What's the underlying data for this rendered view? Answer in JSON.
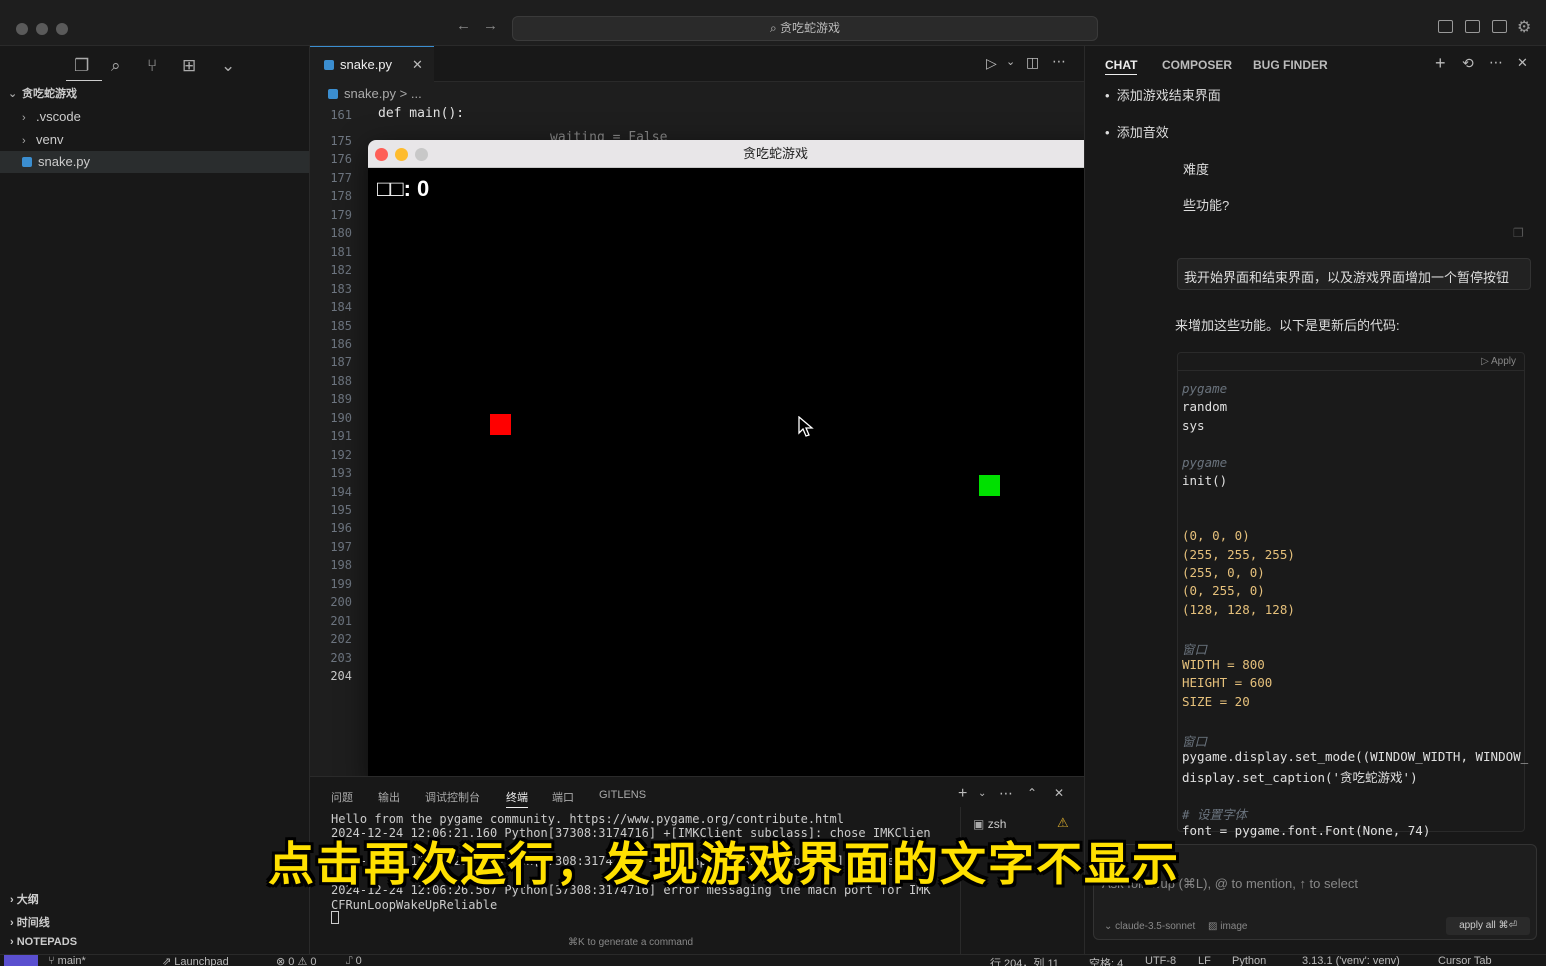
{
  "titlebar": {
    "search_label": "⌕ 贪吃蛇游戏"
  },
  "sidebar": {
    "root_folder": "贪吃蛇游戏",
    "items": [
      {
        "label": ".vscode",
        "type": "folder"
      },
      {
        "label": "venv",
        "type": "folder"
      },
      {
        "label": "snake.py",
        "type": "file",
        "selected": true
      }
    ],
    "sections": [
      "大纲",
      "时间线",
      "NOTEPADS"
    ]
  },
  "editor": {
    "tab_label": "snake.py",
    "breadcrumb": "snake.py > ...",
    "first_line_number": "161",
    "first_line_code": "def main():",
    "peek_line": "waiting = False",
    "line_numbers": [
      "175",
      "176",
      "177",
      "178",
      "179",
      "180",
      "181",
      "182",
      "183",
      "184",
      "185",
      "186",
      "187",
      "188",
      "189",
      "190",
      "191",
      "192",
      "193",
      "194",
      "195",
      "196",
      "197",
      "198",
      "199",
      "200",
      "201",
      "202",
      "203",
      "204"
    ],
    "current_line": "204"
  },
  "game_window": {
    "title": "贪吃蛇游戏",
    "score_label": "□□: 0",
    "pause_label": "||",
    "colors": {
      "food": "#ff0000",
      "snake": "#00e000",
      "background": "#000000"
    }
  },
  "panel": {
    "tabs": [
      "问题",
      "输出",
      "调试控制台",
      "终端",
      "端口",
      "GITLENS"
    ],
    "active_tab": "终端",
    "terminal_lines": [
      "Hello from the pygame community. https://www.pygame.org/contribute.html",
      "2024-12-24 12:06:21.160 Python[37308:3174716] +[IMKClient subclass]: chose IMKClien",
      "2024-12-24 12:06:21.1 Python[37308:3174716] +[IMKInputSession subclass]: chose",
      "2024-12-24 12:06:26.567 Python[37308:3174716] error messaging the mach port for IMK",
      "CFRunLoopWakeUpReliable"
    ],
    "shell_name": "zsh",
    "command_hint": "⌘K to generate a command"
  },
  "chat": {
    "tabs": [
      "CHAT",
      "COMPOSER",
      "BUG FINDER"
    ],
    "bullets": [
      "添加游戏结束界面",
      "添加音效"
    ],
    "partial_lines": [
      "难度",
      "些功能?"
    ],
    "user_message": "我开始界面和结束界面，以及游戏界面增加一个暂停按钮",
    "assistant_intro": "来增加这些功能。以下是更新后的代码:",
    "apply_label": "Apply",
    "code_lines": [
      "pygame",
      "random",
      "sys",
      "",
      "pygame",
      "init()",
      "",
      "",
      "(0, 0, 0)",
      "(255, 255, 255)",
      "(255, 0, 0)",
      "(0, 255, 0)",
      "(128, 128, 128)",
      "",
      "窗口",
      "WIDTH = 800",
      "HEIGHT = 600",
      "SIZE = 20",
      "",
      "窗口",
      "pygame.display.set_mode((WINDOW_WIDTH, WINDOW_",
      "display.set_caption('贪吃蛇游戏')",
      "",
      "# 设置字体",
      "font = pygame.font.Font(None, 74)"
    ],
    "input_placeholder": "Ask followup (⌘L), @ to mention, ↑ to select",
    "model": "claude-3.5-sonnet",
    "image_label": "image",
    "apply_all": "apply all ⌘⏎"
  },
  "statusbar": {
    "branch": "main*",
    "launchpad": "Launchpad",
    "problems": "⊗ 0 ⚠ 0",
    "ports": "⑀ 0",
    "position": "行 204，列 11",
    "spaces": "空格: 4",
    "encoding": "UTF-8",
    "eol": "LF",
    "language": "Python",
    "interpreter": "3.13.1 ('venv': venv)",
    "cursor_tab": "Cursor Tab"
  },
  "subtitle": "点击再次运行，发现游戏界面的文字不显示"
}
